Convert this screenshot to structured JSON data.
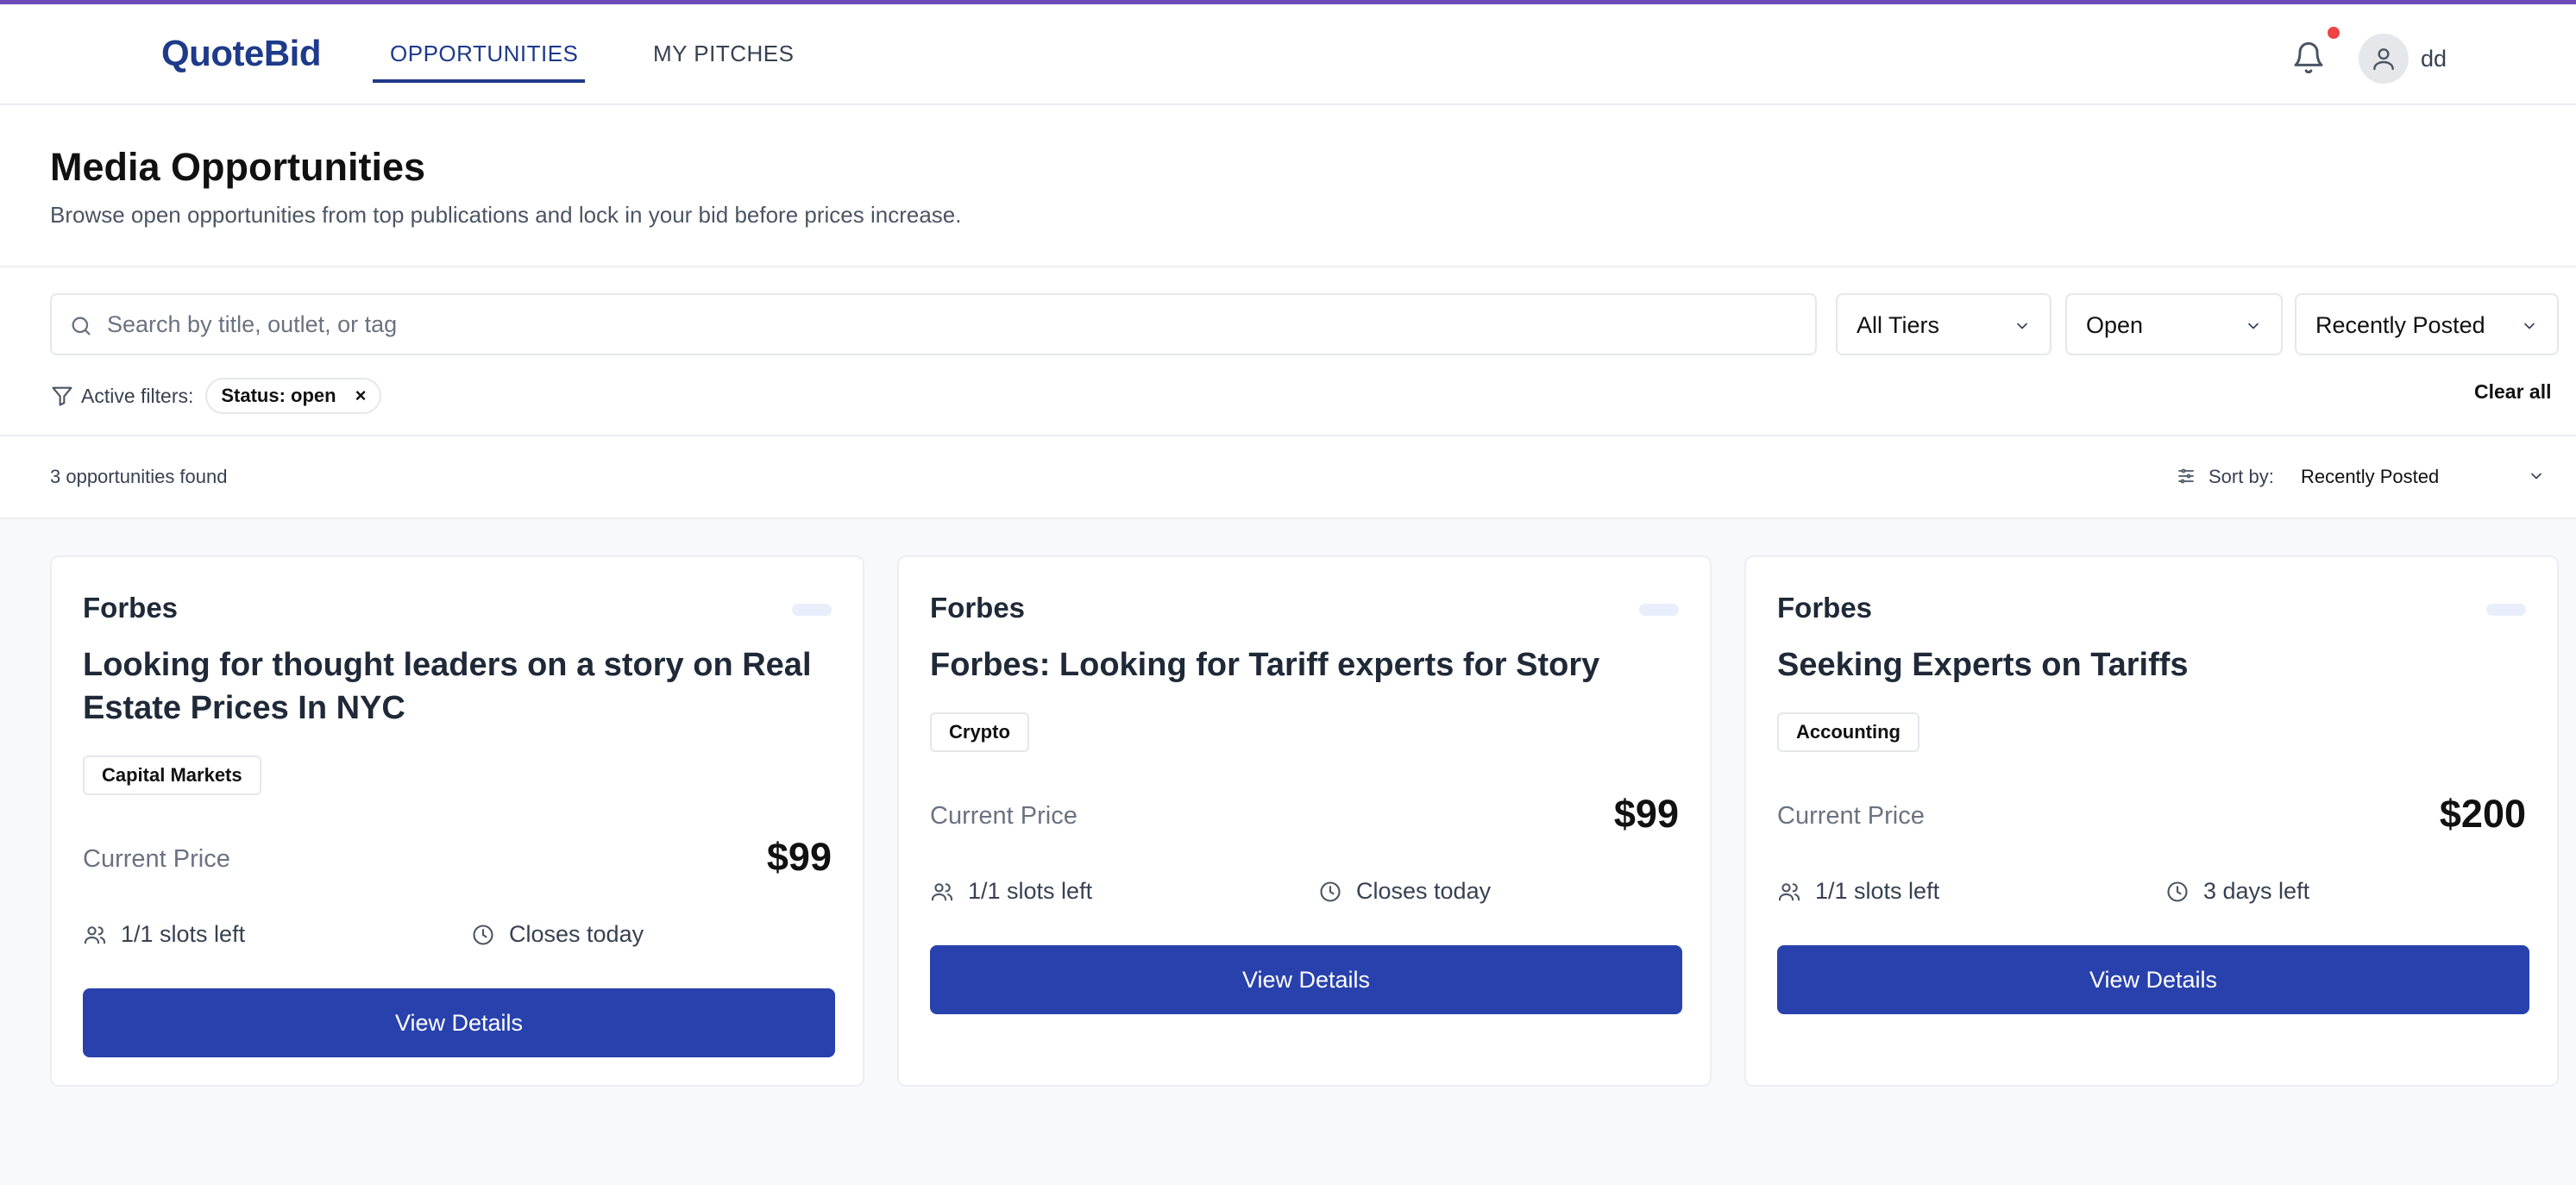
{
  "colors": {
    "accent": "#6c4bb6",
    "brand": "#1e3a8a",
    "button": "#2841ad",
    "notification_dot": "#ef4444"
  },
  "header": {
    "logo": "QuoteBid",
    "tabs": [
      {
        "label": "OPPORTUNITIES",
        "active": true
      },
      {
        "label": "MY PITCHES",
        "active": false
      }
    ],
    "icons": {
      "notifications": "bell-icon",
      "user": "user-icon"
    },
    "username": "dd"
  },
  "page": {
    "title": "Media Opportunities",
    "subtitle": "Browse open opportunities from top publications and lock in your bid before prices increase."
  },
  "filters": {
    "search_placeholder": "Search by title, outlet, or tag",
    "tier": "All Tiers",
    "status": "Open",
    "sort": "Recently Posted",
    "active_label": "Active filters:",
    "active_chip": "Status: open",
    "chip_remove": "×",
    "clear_all": "Clear all"
  },
  "results": {
    "count_text": "3 opportunities found",
    "sort_label": "Sort by:",
    "sort_value": "Recently Posted"
  },
  "cards": [
    {
      "outlet": "Forbes",
      "title": "Looking for thought leaders on a story on Real Estate Prices In NYC",
      "tag": "Capital Markets",
      "price_label": "Current Price",
      "price": "$99",
      "slots": "1/1 slots left",
      "closes": "Closes today",
      "button": "View Details"
    },
    {
      "outlet": "Forbes",
      "title": "Forbes: Looking for Tariff experts for Story",
      "tag": "Crypto",
      "price_label": "Current Price",
      "price": "$99",
      "slots": "1/1 slots left",
      "closes": "Closes today",
      "button": "View Details"
    },
    {
      "outlet": "Forbes",
      "title": "Seeking Experts on Tariffs",
      "tag": "Accounting",
      "price_label": "Current Price",
      "price": "$200",
      "slots": "1/1 slots left",
      "closes": "3 days left",
      "button": "View Details"
    }
  ]
}
